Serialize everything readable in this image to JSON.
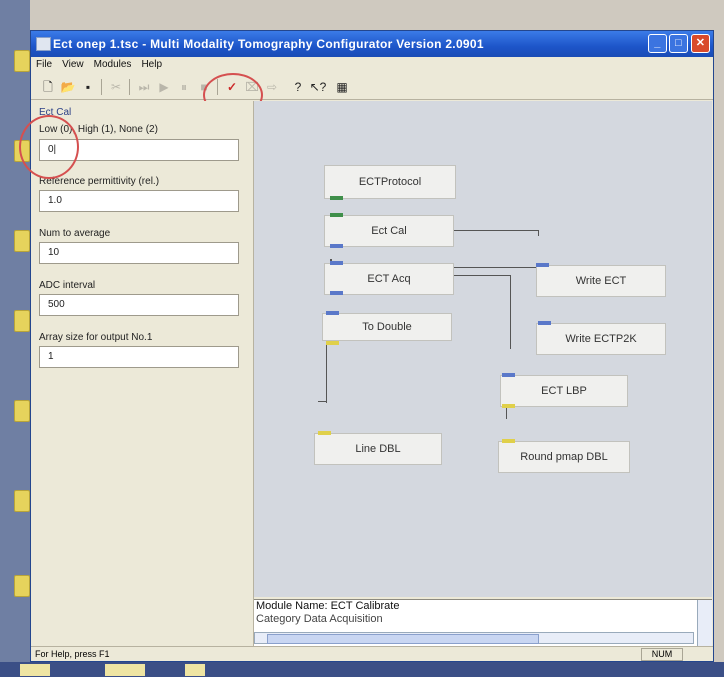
{
  "window": {
    "title": "Ect onep 1.tsc - Multi Modality Tomography Configurator Version 2.0901"
  },
  "menu": [
    "File",
    "View",
    "Modules",
    "Help"
  ],
  "toolbar": {
    "icons": [
      "new-file-icon",
      "open-folder-icon",
      "save-icon",
      "cut-icon",
      "step-icon",
      "play-icon",
      "pause-icon",
      "stop-icon",
      "check-icon",
      "clear-icon",
      "export-icon",
      "help-icon",
      "context-help-icon",
      "grid-icon"
    ],
    "check_glyph": "✓"
  },
  "left_panel": {
    "title": "Ect Cal",
    "params": [
      {
        "label": "Low (0), High (1), None (2)",
        "value": "0|"
      },
      {
        "label": "Reference permittivity (rel.)",
        "value": "1.0"
      },
      {
        "label": "Num to average",
        "value": "10"
      },
      {
        "label": "ADC interval",
        "value": "500"
      },
      {
        "label": "Array size for output No.1",
        "value": "1"
      }
    ]
  },
  "canvas": {
    "nodes": {
      "ectprotocol": "ECTProtocol",
      "ectcal": "Ect Cal",
      "ectacq": "ECT Acq",
      "writeect": "Write ECT",
      "todouble": "To Double",
      "writeectp2k": "Write ECTP2K",
      "ectlbp": "ECT LBP",
      "linedbl": "Line DBL",
      "roundpmap": "Round pmap DBL"
    }
  },
  "info": {
    "line1": "Module Name: ECT Calibrate",
    "line2": "Category    Data Acquisition"
  },
  "status": {
    "help": "For Help, press F1",
    "num": "NUM"
  },
  "colors": {
    "port_in": "#5a78c9",
    "port_out_yellow": "#e0d04a",
    "port_green": "#3f8f4a",
    "annotation": "#d55050"
  }
}
